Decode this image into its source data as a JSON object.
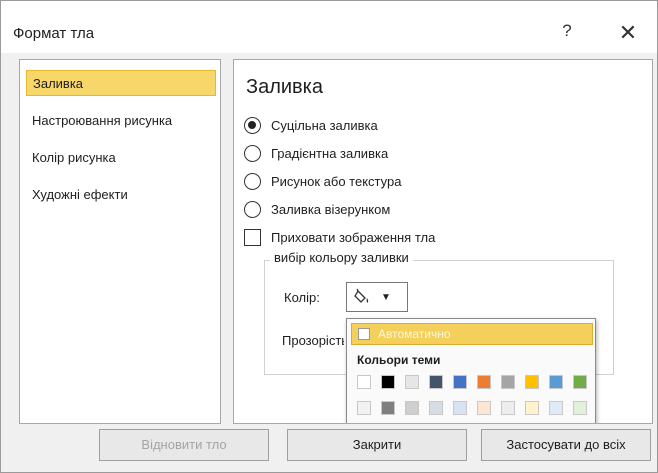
{
  "dialog": {
    "title": "Формат тла",
    "help_label": "?",
    "close_label": "✕"
  },
  "nav": {
    "items": [
      {
        "label": "Заливка",
        "active": true
      },
      {
        "label": "Настроювання рисунка",
        "active": false
      },
      {
        "label": "Колір рисунка",
        "active": false
      },
      {
        "label": "Художні ефекти",
        "active": false
      }
    ]
  },
  "fill": {
    "section_title": "Заливка",
    "options": [
      {
        "label": "Суцільна заливка",
        "checked": true
      },
      {
        "label": "Градієнтна заливка",
        "checked": false
      },
      {
        "label": "Рисунок або текстура",
        "checked": false
      },
      {
        "label": "Заливка візерунком",
        "checked": false
      }
    ],
    "hide_background_label": "Приховати зображення тла",
    "hide_background_checked": false,
    "group_label": "вибір кольору заливки",
    "color_label": "Колір:",
    "transparency_label": "Прозорість",
    "color_icon": "paint-bucket-icon"
  },
  "color_popup": {
    "automatic_label": "Автоматично",
    "theme_colors_title": "Кольори теми",
    "theme_row1": [
      "#ffffff",
      "#000000",
      "#e7e6e6",
      "#44546a",
      "#4472c4",
      "#ed7d31",
      "#a5a5a5",
      "#ffc000",
      "#5b9bd5",
      "#70ad47"
    ],
    "theme_row2": [
      "#f2f2f2",
      "#7f7f7f",
      "#d0cece",
      "#d6dce4",
      "#d9e2f3",
      "#fbe5d5",
      "#ededed",
      "#fff2cc",
      "#deebf6",
      "#e2efd9"
    ]
  },
  "buttons": {
    "reset_label": "Відновити тло",
    "close_label": "Закрити",
    "apply_all_label": "Застосувати до всіх"
  },
  "colors": {
    "accent": "#f7d66a",
    "popup_highlight": "#f4cf5c"
  }
}
